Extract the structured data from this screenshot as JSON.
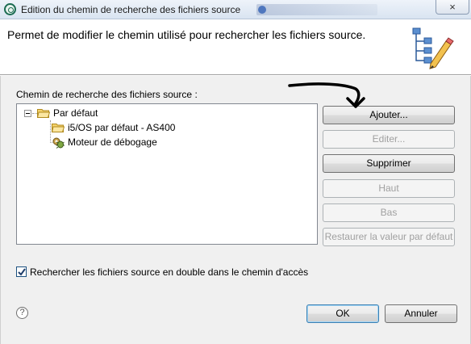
{
  "window": {
    "title": "Edition du chemin de recherche des fichiers source",
    "close_label": "×"
  },
  "header": {
    "description": "Permet de modifier le chemin utilisé pour rechercher les fichiers source.",
    "icon": "path-edit-icon"
  },
  "source_path": {
    "label": "Chemin de recherche des fichiers source :",
    "tree": [
      {
        "label": "Par défaut",
        "icon": "open-folder-icon",
        "expanded": true,
        "selected": true
      },
      {
        "label": "i5/OS par défaut - AS400",
        "icon": "open-folder-icon",
        "level": 1
      },
      {
        "label": "Moteur de débogage",
        "icon": "debug-engine-icon",
        "level": 1
      }
    ]
  },
  "actions": {
    "add": "Ajouter...",
    "edit": "Editer...",
    "delete": "Supprimer",
    "up": "Haut",
    "down": "Bas",
    "restore_default": "Restaurer la valeur par défaut"
  },
  "options": {
    "search_duplicates_label": "Rechercher les fichiers source en double dans le chemin d'accès",
    "search_duplicates_checked": true
  },
  "footer": {
    "help": "?",
    "ok": "OK",
    "cancel": "Annuler"
  },
  "colors": {
    "dialog_bg": "#f0f0f0",
    "default_button_border": "#3c7fb1"
  }
}
